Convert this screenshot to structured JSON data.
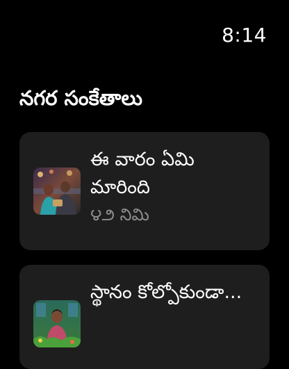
{
  "status_bar": {
    "time": "8:14"
  },
  "section": {
    "title": "నగర సంకేతాలు"
  },
  "cards": [
    {
      "title": "ఈ వారం ఏమి మారింది",
      "meta": "౪౨ నిమి",
      "thumbnail_icon": "market-couple-photo"
    },
    {
      "title": "స్థానం కోల్పోకుండా...",
      "meta": "",
      "thumbnail_icon": "garden-woman-photo"
    }
  ]
}
